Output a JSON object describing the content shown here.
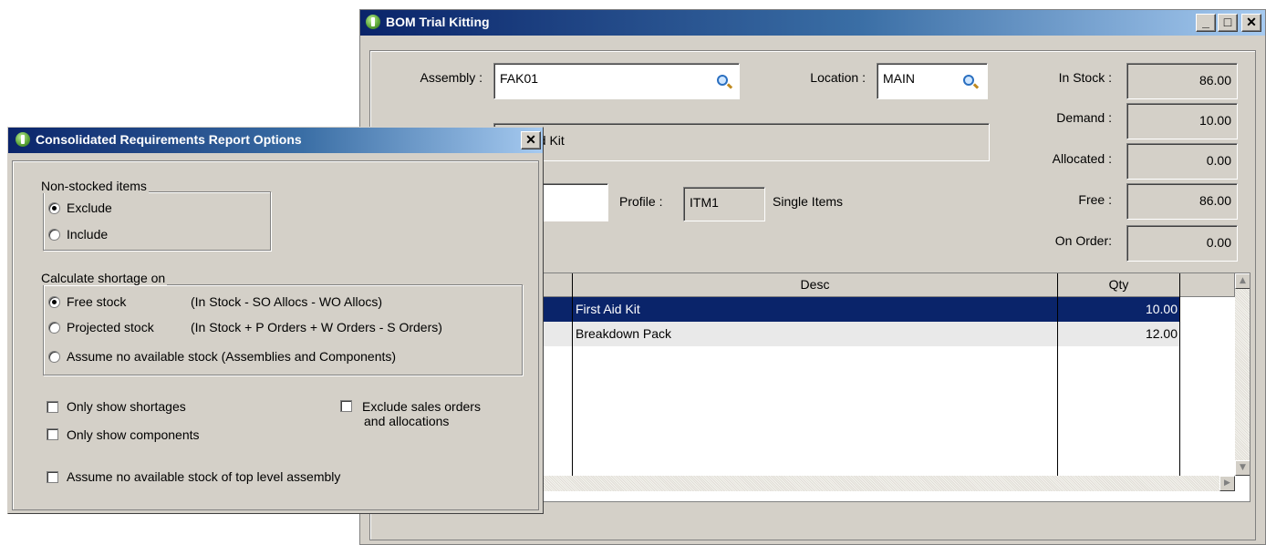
{
  "bom": {
    "title": "BOM Trial Kitting",
    "caption": {
      "minimize": "_",
      "maximize": "□",
      "close": "✕"
    },
    "assembly_label": "Assembly :",
    "assembly_value": "FAK01",
    "location_label": "Location :",
    "location_value": "MAIN",
    "desc_value": "First Aid Kit",
    "profile_label": "Profile :",
    "profile_value": "ITM1",
    "profile_desc": "Single Items",
    "in_stock_label": "In Stock :",
    "in_stock_value": "86.00",
    "demand_label": "Demand :",
    "demand_value": "10.00",
    "allocated_label": "Allocated :",
    "allocated_value": "0.00",
    "free_label": "Free :",
    "free_value": "86.00",
    "on_order_label": "On Order:",
    "on_order_value": "0.00",
    "grid": {
      "headers": {
        "desc": "Desc",
        "qty": "Qty"
      },
      "rows": [
        {
          "desc": "First Aid Kit",
          "qty": "10.00"
        },
        {
          "desc": "Breakdown Pack",
          "qty": "12.00"
        }
      ]
    }
  },
  "dialog": {
    "title": "Consolidated Requirements Report Options",
    "close": "✕",
    "nonstocked": {
      "legend": "Non-stocked items",
      "exclude": "Exclude",
      "include": "Include",
      "selected": "exclude"
    },
    "shortage": {
      "legend": "Calculate shortage on",
      "free": "Free stock",
      "free_note": "(In Stock - SO Allocs - WO Allocs)",
      "projected": "Projected stock",
      "projected_note": "(In Stock + P Orders + W Orders - S Orders)",
      "assume": "Assume no available stock (Assemblies and Components)",
      "selected": "free"
    },
    "checks": {
      "only_shortages": "Only show shortages",
      "only_components": "Only show components",
      "exclude_sales_line1": "Exclude sales orders",
      "exclude_sales_line2": "and allocations",
      "assume_top": "Assume no available stock of top level assembly"
    }
  },
  "icons": [
    "app-icon",
    "search-icon",
    "close-icon",
    "minimize-icon",
    "maximize-icon",
    "scroll-up-icon",
    "scroll-down-icon",
    "scroll-right-icon"
  ]
}
